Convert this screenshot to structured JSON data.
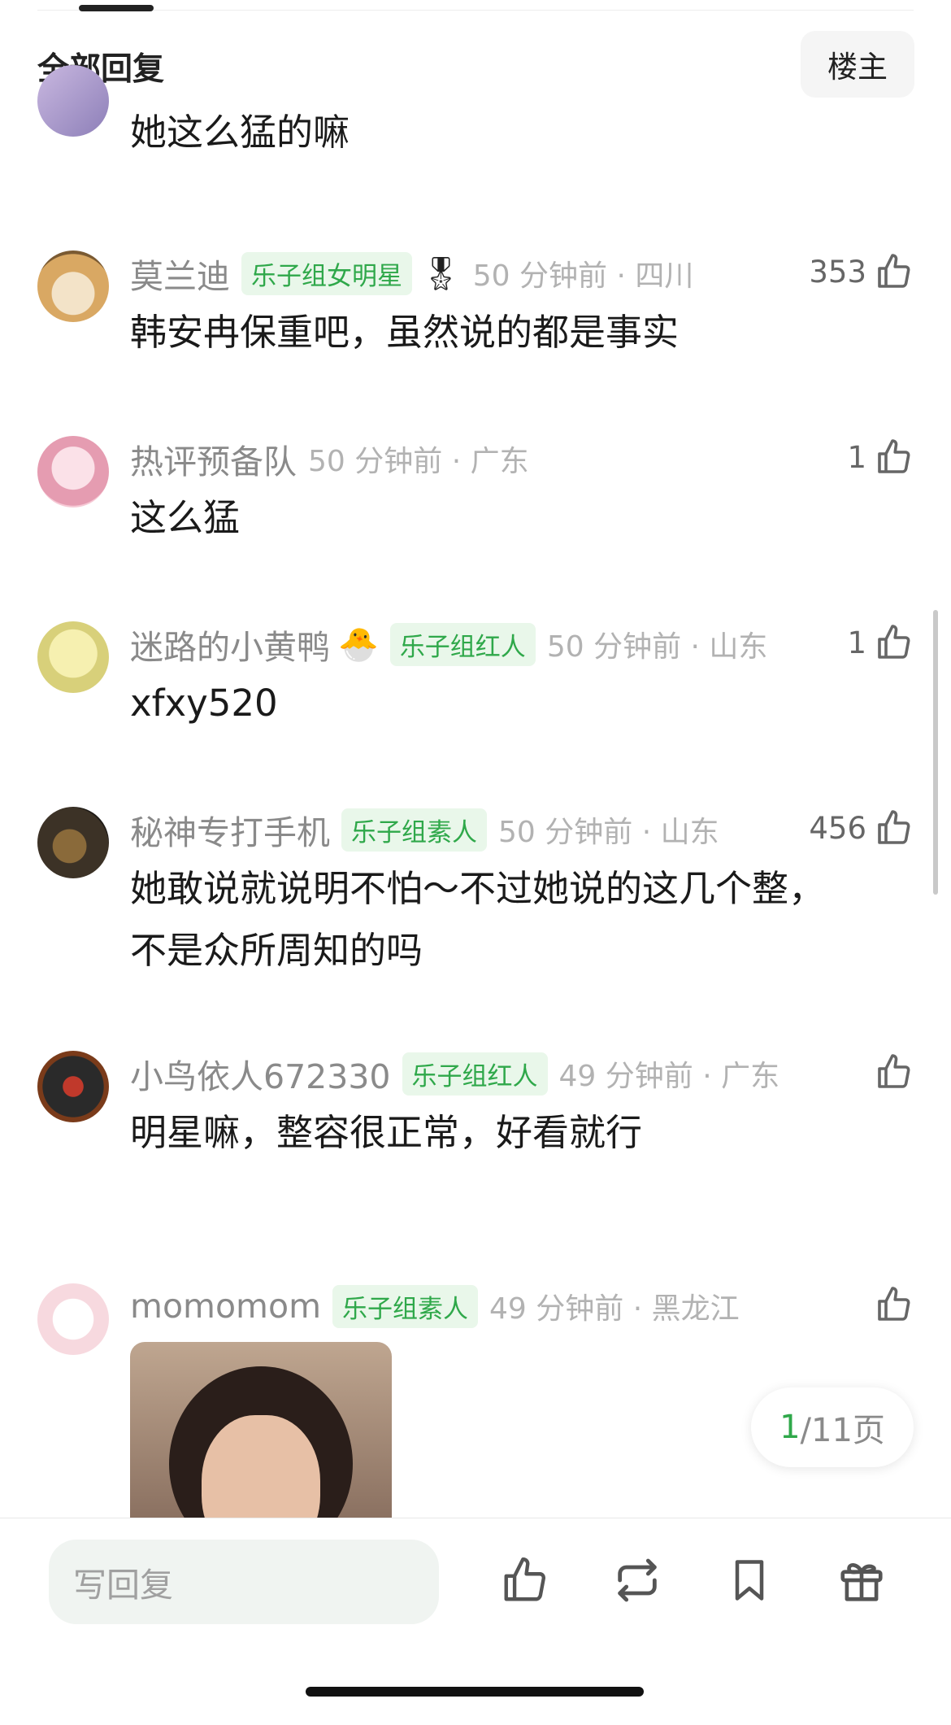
{
  "header": {
    "title": "全部回复",
    "owner_button": "楼主"
  },
  "comments": [
    {
      "text": "她这么猛的嘛"
    },
    {
      "username": "莫兰迪",
      "badge": "乐子组女明星",
      "time": "50 分钟前",
      "location": "四川",
      "likes": "353",
      "text_lines": [
        "韩安冉保重吧，虽然说的都是事实"
      ]
    },
    {
      "username": "热评预备队",
      "time": "50 分钟前",
      "location": "广东",
      "likes": "1",
      "text_lines": [
        "这么猛"
      ]
    },
    {
      "username": "迷路的小黄鸭",
      "badge": "乐子组红人",
      "time": "50 分钟前",
      "location": "山东",
      "likes": "1",
      "text_lines": [
        "xfxy520"
      ]
    },
    {
      "username": "秘神专打手机",
      "badge": "乐子组素人",
      "time": "50 分钟前",
      "location": "山东",
      "likes": "456",
      "text_lines": [
        "她敢说就说明不怕～不过她说的这几个整，",
        "不是众所周知的吗"
      ]
    },
    {
      "username": "小鸟依人672330",
      "badge": "乐子组红人",
      "time": "49 分钟前",
      "location": "广东",
      "likes": "",
      "text_lines": [
        "明星嘛，整容很正常，好看就行"
      ]
    },
    {
      "username": "momomom",
      "badge": "乐子组素人",
      "time": "49 分钟前",
      "location": "黑龙江",
      "likes": ""
    }
  ],
  "pager": {
    "current": "1",
    "rest": "/11页"
  },
  "bottom_bar": {
    "reply_placeholder": "写回复"
  },
  "colors": {
    "accent_green": "#2fa84a",
    "badge_bg": "#e9f7ea",
    "meta_gray": "#b2b2b2"
  }
}
